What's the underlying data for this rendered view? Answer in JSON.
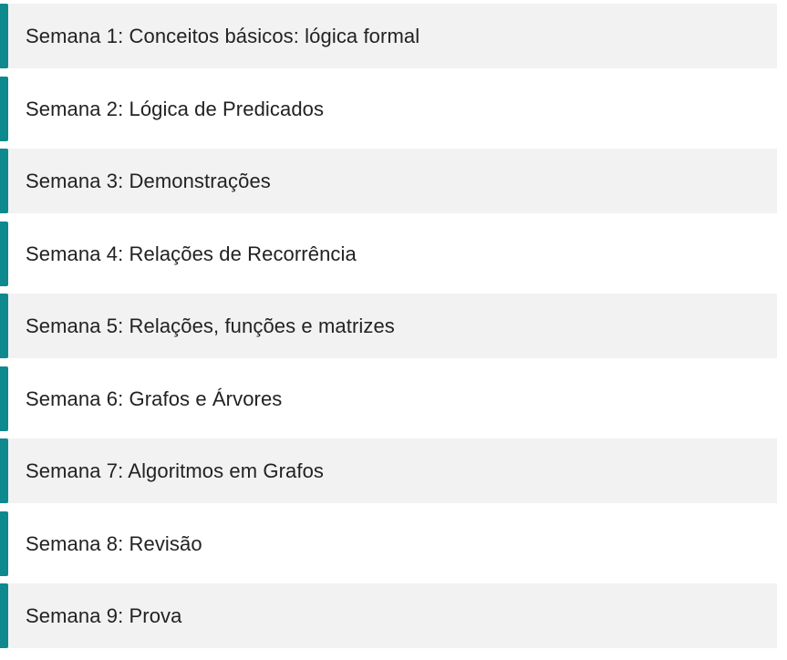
{
  "colors": {
    "accent": "#0E8A8F",
    "row_shaded": "#F2F2F2",
    "row_plain": "#FFFFFF",
    "text": "#222222"
  },
  "weeks": [
    {
      "label": "Semana 1: Conceitos básicos: lógica formal",
      "shaded": true
    },
    {
      "label": "Semana 2: Lógica de Predicados",
      "shaded": false
    },
    {
      "label": "Semana 3: Demonstrações",
      "shaded": true
    },
    {
      "label": "Semana 4: Relações de Recorrência",
      "shaded": false
    },
    {
      "label": "Semana 5: Relações, funções e matrizes",
      "shaded": true
    },
    {
      "label": "Semana 6: Grafos e Árvores",
      "shaded": false
    },
    {
      "label": "Semana 7: Algoritmos em Grafos",
      "shaded": true
    },
    {
      "label": "Semana 8: Revisão",
      "shaded": false
    },
    {
      "label": "Semana 9: Prova",
      "shaded": true
    }
  ]
}
